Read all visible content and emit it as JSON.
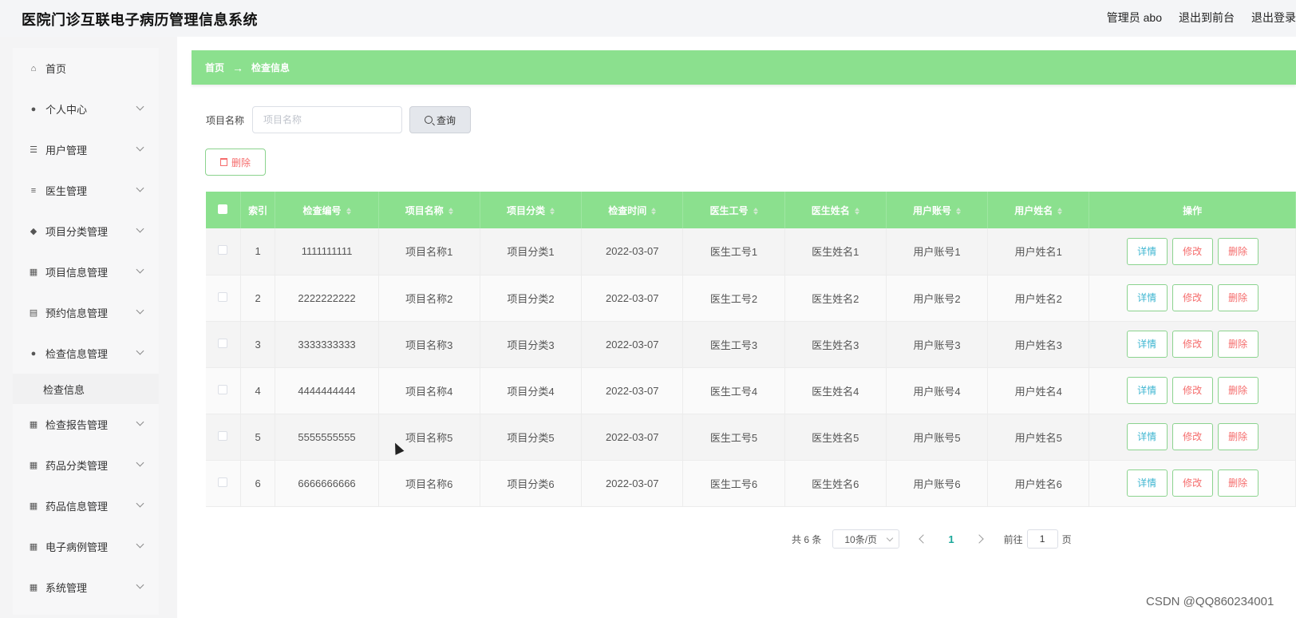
{
  "app": {
    "title": "医院门诊互联电子病历管理信息系统"
  },
  "header": {
    "admin": "管理员 abo",
    "to_front": "退出到前台",
    "logout": "退出登录"
  },
  "sidebar": {
    "items": [
      {
        "label": "首页",
        "icon": "home-icon"
      },
      {
        "label": "个人中心",
        "icon": "user-icon"
      },
      {
        "label": "用户管理",
        "icon": "sliders-icon"
      },
      {
        "label": "医生管理",
        "icon": "list-icon"
      },
      {
        "label": "项目分类管理",
        "icon": "location-icon"
      },
      {
        "label": "项目信息管理",
        "icon": "grid-icon"
      },
      {
        "label": "预约信息管理",
        "icon": "clipboard-icon"
      },
      {
        "label": "检查信息管理",
        "icon": "user-icon"
      },
      {
        "label": "检查报告管理",
        "icon": "grid-icon"
      },
      {
        "label": "药品分类管理",
        "icon": "grid-icon"
      },
      {
        "label": "药品信息管理",
        "icon": "grid-icon"
      },
      {
        "label": "电子病例管理",
        "icon": "grid-icon"
      },
      {
        "label": "系统管理",
        "icon": "grid-icon"
      }
    ],
    "sub_item": "检查信息"
  },
  "breadcrumb": {
    "home": "首页",
    "arrow": "→",
    "current": "检查信息"
  },
  "search": {
    "label": "项目名称",
    "placeholder": "项目名称",
    "button": "查询"
  },
  "toolbar": {
    "delete_label": "删除"
  },
  "table": {
    "headers": [
      "索引",
      "检查编号",
      "项目名称",
      "项目分类",
      "检查时间",
      "医生工号",
      "医生姓名",
      "用户账号",
      "用户姓名",
      "操作"
    ],
    "rows": [
      [
        "1",
        "1111111111",
        "项目名称1",
        "项目分类1",
        "2022-03-07",
        "医生工号1",
        "医生姓名1",
        "用户账号1",
        "用户姓名1"
      ],
      [
        "2",
        "2222222222",
        "项目名称2",
        "项目分类2",
        "2022-03-07",
        "医生工号2",
        "医生姓名2",
        "用户账号2",
        "用户姓名2"
      ],
      [
        "3",
        "3333333333",
        "项目名称3",
        "项目分类3",
        "2022-03-07",
        "医生工号3",
        "医生姓名3",
        "用户账号3",
        "用户姓名3"
      ],
      [
        "4",
        "4444444444",
        "项目名称4",
        "项目分类4",
        "2022-03-07",
        "医生工号4",
        "医生姓名4",
        "用户账号4",
        "用户姓名4"
      ],
      [
        "5",
        "5555555555",
        "项目名称5",
        "项目分类5",
        "2022-03-07",
        "医生工号5",
        "医生姓名5",
        "用户账号5",
        "用户姓名5"
      ],
      [
        "6",
        "6666666666",
        "项目名称6",
        "项目分类6",
        "2022-03-07",
        "医生工号6",
        "医生姓名6",
        "用户账号6",
        "用户姓名6"
      ]
    ],
    "actions": {
      "detail": "详情",
      "edit": "修改",
      "delete": "删除"
    }
  },
  "pagination": {
    "total": "共 6 条",
    "page_size": "10条/页",
    "current": "1",
    "goto_prefix": "前往",
    "goto_value": "1",
    "goto_suffix": "页"
  },
  "watermark": "CSDN @QQ860234001",
  "colors": {
    "accent": "#8be08e",
    "danger": "#f56c6c",
    "info": "#3fb6d1"
  }
}
